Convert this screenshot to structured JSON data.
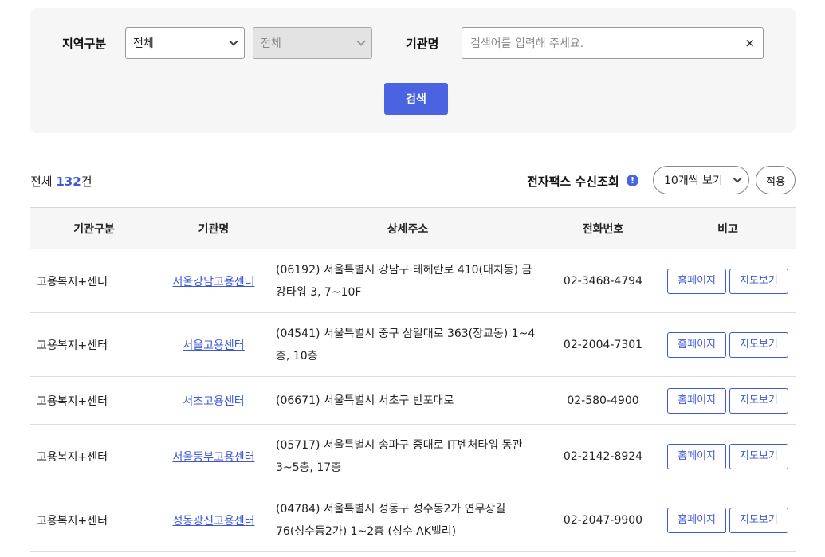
{
  "search": {
    "region_label": "지역구분",
    "region_select": "전체",
    "subregion_select": "전체",
    "org_label": "기관명",
    "org_placeholder": "검색어를 입력해 주세요.",
    "clear_icon": "×",
    "search_button": "검색"
  },
  "summary": {
    "total_prefix": "전체 ",
    "total_count": "132",
    "total_suffix": "건",
    "fax_label": "전자팩스 수신조회",
    "info_icon": "!",
    "per_page": "10개씩 보기",
    "apply": "적용"
  },
  "table": {
    "headers": [
      "기관구분",
      "기관명",
      "상세주소",
      "전화번호",
      "비고"
    ],
    "rows": [
      {
        "type": "고용복지+센터",
        "name": "서울강남고용센터",
        "address": "(06192) 서울특별시 강남구 테헤란로 410(대치동) 금강타워 3, 7~10F",
        "phone": "02-3468-4794",
        "home": "홈페이지",
        "map": "지도보기"
      },
      {
        "type": "고용복지+센터",
        "name": "서울고용센터",
        "address": "(04541) 서울특별시 중구 삼일대로 363(장교동) 1~4층, 10층",
        "phone": "02-2004-7301",
        "home": "홈페이지",
        "map": "지도보기"
      },
      {
        "type": "고용복지+센터",
        "name": "서초고용센터",
        "address": "(06671) 서울특별시 서초구 반포대로",
        "phone": "02-580-4900",
        "home": "홈페이지",
        "map": "지도보기"
      },
      {
        "type": "고용복지+센터",
        "name": "서울동부고용센터",
        "address": "(05717) 서울특별시 송파구 중대로 IT벤처타워 동관 3~5층, 17층",
        "phone": "02-2142-8924",
        "home": "홈페이지",
        "map": "지도보기"
      },
      {
        "type": "고용복지+센터",
        "name": "성동광진고용센터",
        "address": "(04784) 서울특별시 성동구 성수동2가 연무장길 76(성수동2가) 1~2층 (성수 AK밸리)",
        "phone": "02-2047-9900",
        "home": "홈페이지",
        "map": "지도보기"
      }
    ]
  },
  "colors": {
    "accent": "#4a63e0",
    "link": "#3d58d8",
    "panel_bg": "#f6f6f6"
  }
}
